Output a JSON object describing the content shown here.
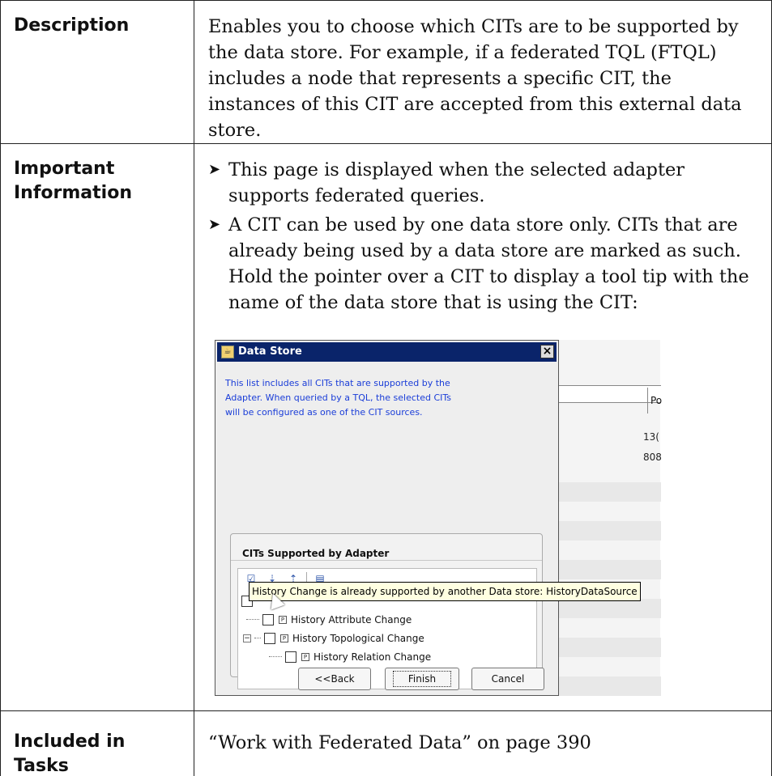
{
  "rows": {
    "description": {
      "label": "Description",
      "text": "Enables you to choose which CITs are to be supported by the data store. For example, if a federated TQL (FTQL) includes a node that represents a specific CIT, the instances of this CIT are accepted from this external data store."
    },
    "important": {
      "label": "Important Information",
      "bullets": [
        "This page is displayed when the selected adapter supports federated queries.",
        "A CIT can be used by one data store only. CITs that are already being used by a data store are marked as such. Hold the pointer over a CIT to display a tool tip with the name of the data store that is using the CIT:"
      ],
      "bullet_glyph": "➤"
    },
    "tasks": {
      "label": "Included in Tasks",
      "text": "“Work with Federated Data” on page 390"
    }
  },
  "screenshot": {
    "title": "Data Store",
    "close_glyph": "×",
    "description": "This list includes all CITs that are supported by the Adapter. When queried by a TQL, the selected CITs will be configured as one of the CIT sources.",
    "group_title": "CITs Supported by Adapter",
    "tooltip": "History Change is already supported by another Data store: HistoryDataSource",
    "tree_items": [
      "History Attribute Change",
      "History Topological Change",
      "History Relation Change"
    ],
    "buttons": {
      "back": "<<Back",
      "finish": "Finish",
      "cancel": "Cancel"
    },
    "background": {
      "column_header": "Po",
      "values": [
        "13(",
        "808"
      ]
    }
  }
}
